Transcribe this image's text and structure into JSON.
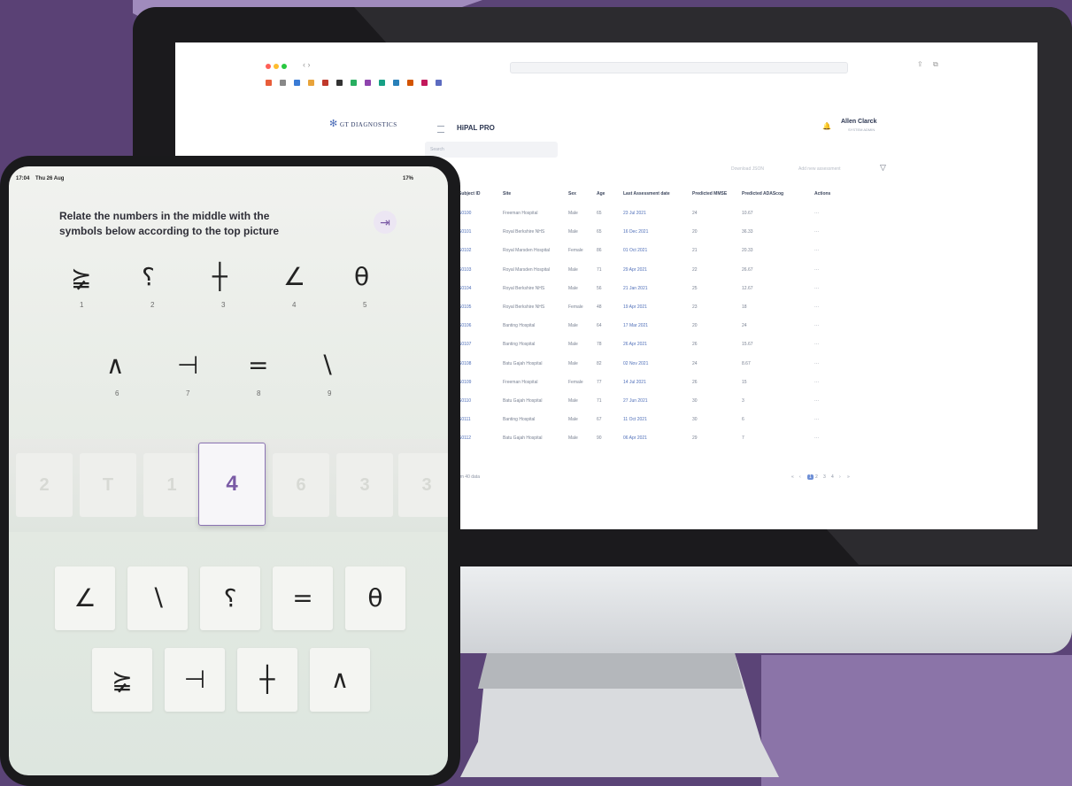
{
  "browser": {
    "url_text": ""
  },
  "app": {
    "logo_text": "GT DIAGNOSTICS",
    "title": "HiPAL PRO",
    "search_placeholder": "Search",
    "download_label": "Download JSON",
    "add_label": "Add new assessment",
    "user_name": "Allen Clarck",
    "user_role": "SYSTEM ADMIN",
    "table": {
      "headers": [
        "Subject ID",
        "Site",
        "Sex",
        "Age",
        "Last Assessment date",
        "Predicted MMSE",
        "Predicted ADAScog",
        "Actions"
      ],
      "rows": [
        [
          "S0100",
          "Freeman Hospital",
          "Male",
          "65",
          "23 Jul 2021",
          "24",
          "10.67",
          "···"
        ],
        [
          "S0101",
          "Royal Berkshire NHS",
          "Male",
          "65",
          "16 Dec 2021",
          "20",
          "36.33",
          "···"
        ],
        [
          "S0102",
          "Royal Marsden Hospital",
          "Female",
          "86",
          "01 Oct 2021",
          "21",
          "20.33",
          "···"
        ],
        [
          "S0103",
          "Royal Marsden Hospital",
          "Male",
          "71",
          "29 Apr 2021",
          "22",
          "26.67",
          "···"
        ],
        [
          "S0104",
          "Royal Berkshire NHS",
          "Male",
          "56",
          "21 Jan 2021",
          "25",
          "12.67",
          "···"
        ],
        [
          "S0105",
          "Royal Berkshire NHS",
          "Female",
          "48",
          "19 Apr 2021",
          "23",
          "18",
          "···"
        ],
        [
          "S0106",
          "Banting Hospital",
          "Male",
          "64",
          "17 Mar 2021",
          "20",
          "24",
          "···"
        ],
        [
          "S0107",
          "Banting Hospital",
          "Male",
          "78",
          "26 Apr 2021",
          "26",
          "15.67",
          "···"
        ],
        [
          "S0108",
          "Batu Gajah Hospital",
          "Male",
          "82",
          "02 Nov 2021",
          "24",
          "8.67",
          "···"
        ],
        [
          "S0109",
          "Freeman Hospital",
          "Female",
          "77",
          "14 Jul 2021",
          "26",
          "15",
          "···"
        ],
        [
          "S0110",
          "Batu Gajah Hospital",
          "Male",
          "71",
          "27 Jun 2021",
          "30",
          "3",
          "···"
        ],
        [
          "S0111",
          "Banting Hospital",
          "Male",
          "67",
          "11 Oct 2021",
          "30",
          "6",
          "···"
        ],
        [
          "S0112",
          "Batu Gajah Hospital",
          "Male",
          "90",
          "06 Apr 2021",
          "29",
          "7",
          "···"
        ]
      ]
    },
    "footer_text": "ng 20 from 40 data",
    "pages": [
      "«",
      "‹",
      "1",
      "2",
      "3",
      "4",
      "›",
      "»"
    ]
  },
  "ipad": {
    "time": "17:04",
    "date": "Thu 26 Aug",
    "battery": "17%",
    "question": "Relate the numbers in the middle with the symbols below according to the top picture",
    "exit_icon": "exit-icon",
    "reference_row1": [
      {
        "symbol": "⪶",
        "num": "1"
      },
      {
        "symbol": "⸮",
        "num": "2"
      },
      {
        "symbol": "┼",
        "num": "3"
      },
      {
        "symbol": "∠",
        "num": "4"
      },
      {
        "symbol": "θ",
        "num": "5"
      }
    ],
    "reference_row2": [
      {
        "symbol": "∧",
        "num": "6"
      },
      {
        "symbol": "⊣",
        "num": "7"
      },
      {
        "symbol": "=",
        "num": "8"
      },
      {
        "symbol": "∖",
        "num": "9"
      }
    ],
    "carousel": [
      "2",
      "T",
      "1",
      "4",
      "6",
      "3",
      "3"
    ],
    "answer_row1": [
      "∠",
      "∖",
      "⸮",
      "=",
      "θ"
    ],
    "answer_row2": [
      "⪶",
      "⊣",
      "┼",
      "∧"
    ]
  },
  "colors": {
    "background": "#5b4477",
    "accent": "#7a5aa5",
    "link": "#4f6fb9"
  }
}
